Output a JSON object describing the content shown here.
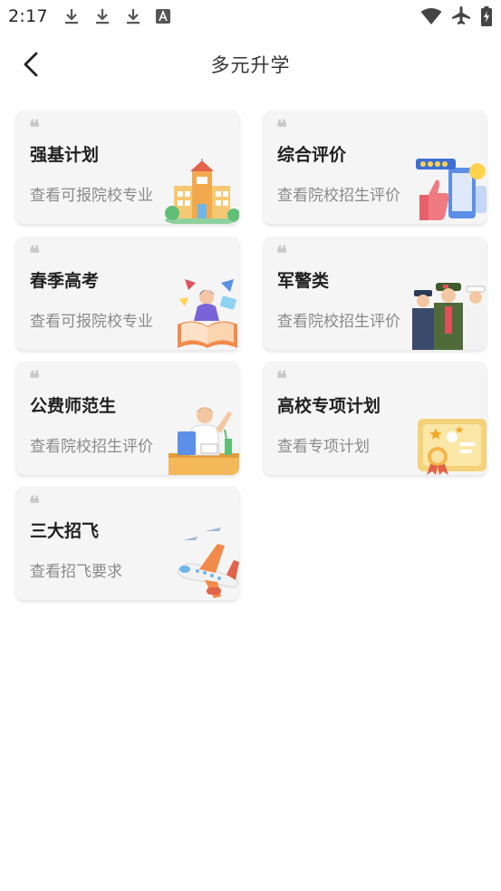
{
  "status_bar": {
    "time": "2:17",
    "icons": [
      "download-icon",
      "download-icon",
      "download-icon",
      "text-a-icon",
      "wifi-icon",
      "airplane-mode-icon",
      "battery-charging-icon"
    ]
  },
  "header": {
    "title": "多元升学",
    "back_icon": "chevron-left-icon"
  },
  "cards": [
    {
      "quote": "❝",
      "title": "强基计划",
      "subtitle": "查看可报院校专业",
      "art": "school-building-illustration"
    },
    {
      "quote": "❝",
      "title": "综合评价",
      "subtitle": "查看院校招生评价",
      "art": "thumbs-up-rating-illustration"
    },
    {
      "quote": "❝",
      "title": "春季高考",
      "subtitle": "查看可报院校专业",
      "art": "student-reading-book-illustration"
    },
    {
      "quote": "❝",
      "title": "军警类",
      "subtitle": "查看院校招生评价",
      "art": "soldiers-police-illustration"
    },
    {
      "quote": "❝",
      "title": "公费师范生",
      "subtitle": "查看院校招生评价",
      "art": "teacher-at-desk-illustration"
    },
    {
      "quote": "❝",
      "title": "高校专项计划",
      "subtitle": "查看专项计划",
      "art": "certificate-illustration"
    },
    {
      "quote": "❝",
      "title": "三大招飞",
      "subtitle": "查看招飞要求",
      "art": "airplane-illustration"
    }
  ],
  "colors": {
    "card_bg": "#f5f5f5",
    "title": "#1f1f1f",
    "subtitle": "#8a8a8a",
    "quote": "#c9c9c9"
  }
}
